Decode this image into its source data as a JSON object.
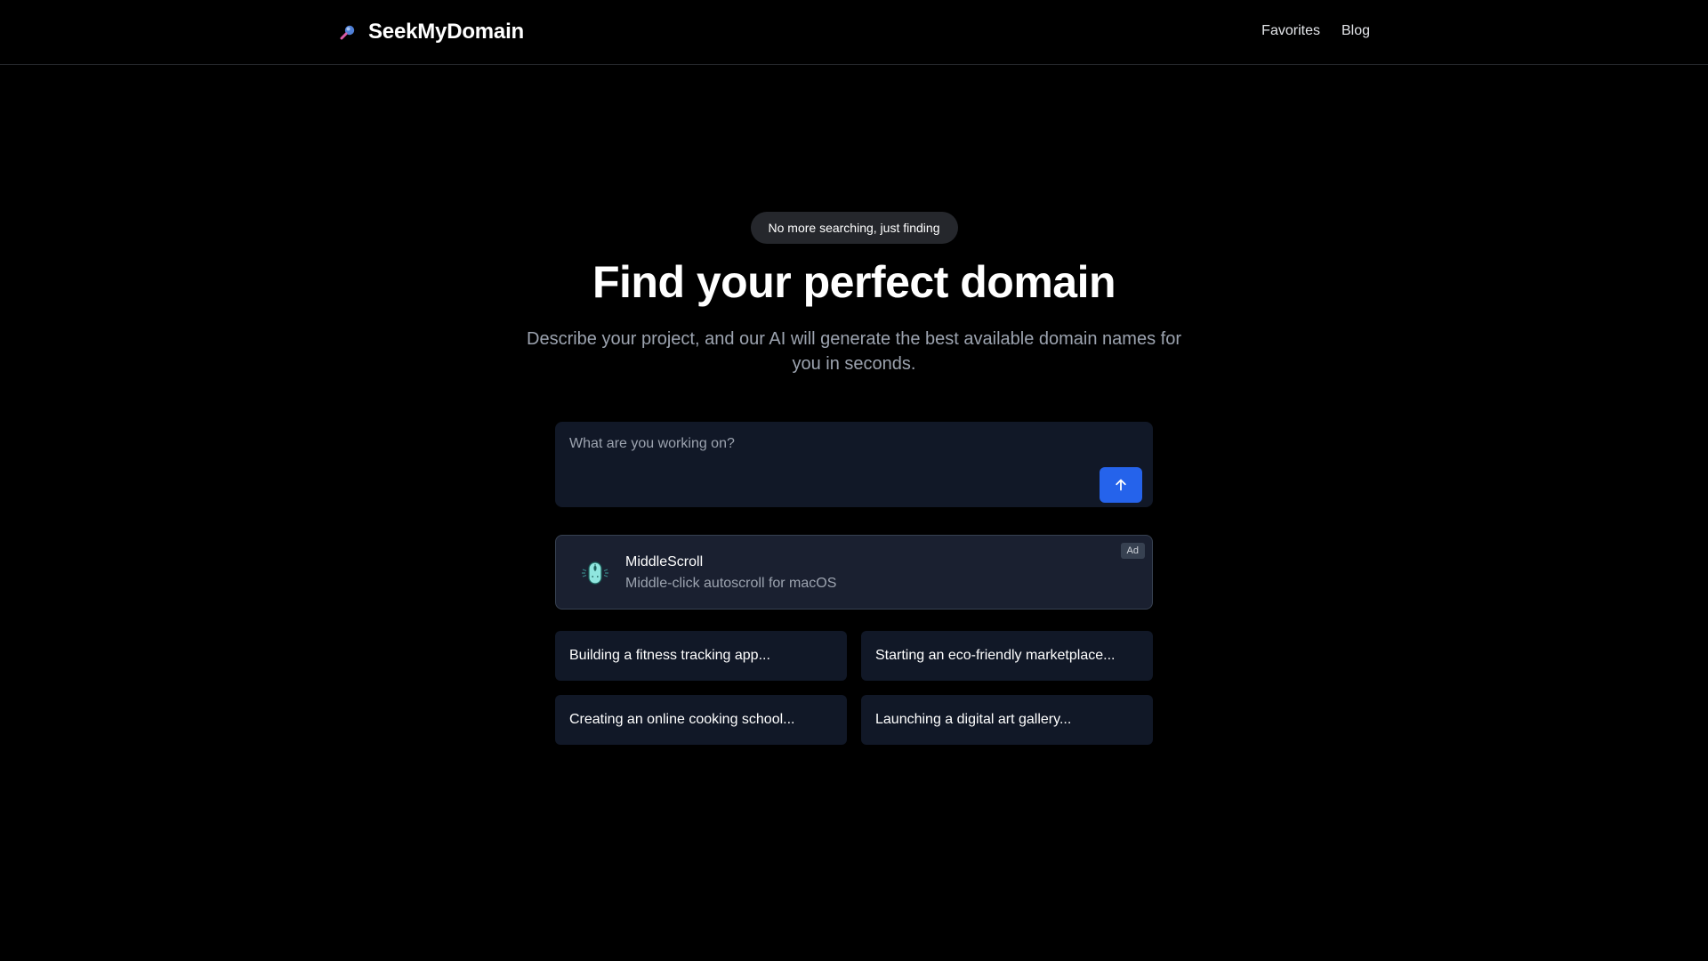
{
  "header": {
    "brand": "SeekMyDomain",
    "nav": [
      {
        "label": "Favorites"
      },
      {
        "label": "Blog"
      }
    ]
  },
  "hero": {
    "badge": "No more searching, just finding",
    "title": "Find your perfect domain",
    "subtitle": "Describe your project, and our AI will generate the best available domain names for you in seconds."
  },
  "search": {
    "placeholder": "What are you working on?",
    "value": "",
    "submit_icon": "arrow-up-icon"
  },
  "ad": {
    "name": "MiddleScroll",
    "description": "Middle-click autoscroll for macOS",
    "badge": "Ad",
    "icon": "mouse-icon"
  },
  "examples": [
    {
      "label": "Building a fitness tracking app..."
    },
    {
      "label": "Starting an eco-friendly marketplace..."
    },
    {
      "label": "Creating an online cooking school..."
    },
    {
      "label": "Launching a digital art gallery..."
    }
  ],
  "colors": {
    "background": "#000000",
    "accent": "#2563eb",
    "card": "#111827",
    "muted_text": "#9ca3af"
  }
}
